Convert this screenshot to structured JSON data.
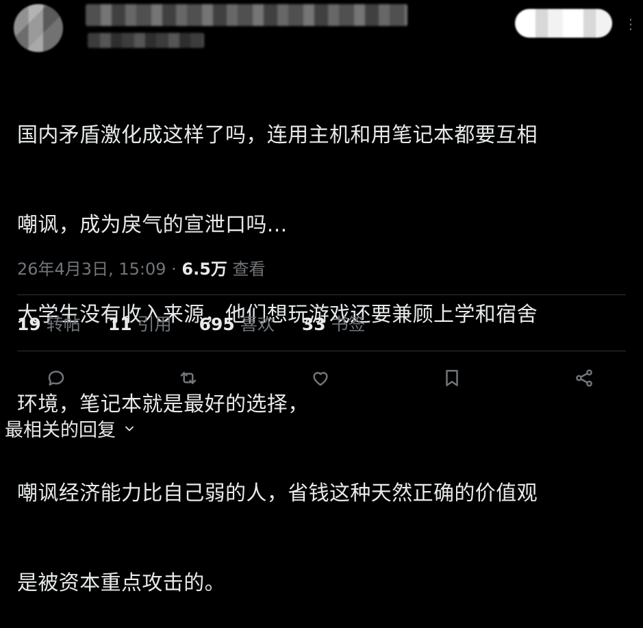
{
  "tweet": {
    "lines": [
      "国内矛盾激化成这样了吗，连用主机和用笔记本都要互相",
      "嘲讽，成为戾气的宣泄口吗...",
      "大学生没有收入来源，他们想玩游戏还要兼顾上学和宿舍",
      "环境，笔记本就是最好的选择，",
      "嘲讽经济能力比自己弱的人，省钱这种天然正确的价值观",
      "是被资本重点攻击的。"
    ]
  },
  "meta": {
    "datetime": "26年4月3日, 15:09",
    "separator": " · ",
    "views_count": "6.5万",
    "views_label": "查看"
  },
  "stats": [
    {
      "num": "19",
      "label": "转帖"
    },
    {
      "num": "11",
      "label": "引用"
    },
    {
      "num": "695",
      "label": "喜欢"
    },
    {
      "num": "33",
      "label": "书签"
    }
  ],
  "actions": {
    "icons": [
      "reply-icon",
      "repost-icon",
      "like-icon",
      "bookmark-icon",
      "share-icon"
    ]
  },
  "replies_sort": {
    "label": "最相关的回复"
  },
  "colors": {
    "background": "#000000",
    "text_primary": "#e7e9ea",
    "text_secondary": "#71767b",
    "divider": "#2f3336"
  }
}
